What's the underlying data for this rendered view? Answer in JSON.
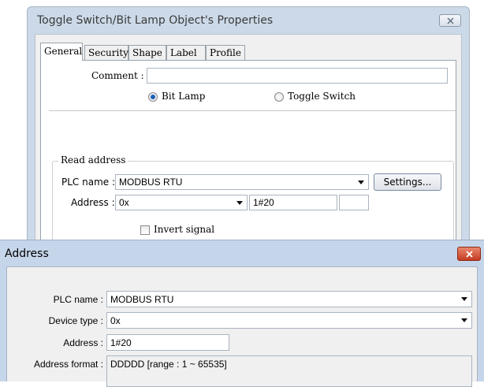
{
  "props_window": {
    "title": "Toggle Switch/Bit Lamp Object's Properties",
    "tabs": [
      {
        "label": "General",
        "active": true
      },
      {
        "label": "Security",
        "active": false
      },
      {
        "label": "Shape",
        "active": false
      },
      {
        "label": "Label",
        "active": false
      },
      {
        "label": "Profile",
        "active": false
      }
    ],
    "comment_label": "Comment :",
    "comment_value": "",
    "mode_options": [
      {
        "label": "Bit Lamp",
        "checked": true
      },
      {
        "label": "Toggle Switch",
        "checked": false
      }
    ],
    "read_address": {
      "group_label": "Read address",
      "plc_name_label": "PLC name :",
      "plc_name_value": "MODBUS RTU",
      "settings_button": "Settings...",
      "address_label": "Address :",
      "device_value": "0x",
      "address_value": "1#20",
      "extra_value": "",
      "invert_label": "Invert signal",
      "invert_checked": false
    }
  },
  "address_window": {
    "title": "Address",
    "plc_name_label": "PLC name :",
    "plc_name_value": "MODBUS RTU",
    "device_type_label": "Device type :",
    "device_type_value": "0x",
    "address_label": "Address :",
    "address_value": "1#20",
    "address_format_label": "Address format :",
    "address_format_value": "DDDDD [range : 1 ~ 65535]"
  },
  "colors": {
    "titlebar": "#ccd9e8",
    "address_titlebar": "#c6d6ea",
    "close_red": "#c43c21",
    "radio_selected": "#1d5fb8"
  }
}
